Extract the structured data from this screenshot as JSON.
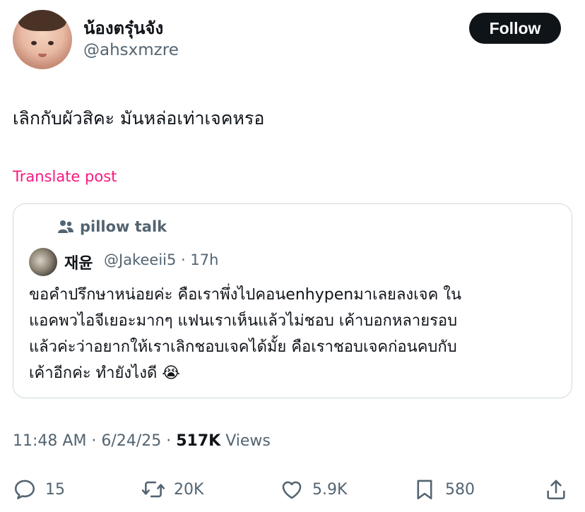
{
  "author": {
    "display_name": "น้องตรุ๋นจัง",
    "handle": "@ahsxmzre",
    "avatar_icon": "user-avatar"
  },
  "follow_label": "Follow",
  "post": {
    "text": "เลิกกับผัวสิคะ มันหล่อเท่าเจคหรอ",
    "translate_label": "Translate post"
  },
  "quote": {
    "community": "pillow talk",
    "author_name": "재윤",
    "author_handle": "@Jakeeii5",
    "separator": "·",
    "time": "17h",
    "lines": [
      "ขอคำปรึกษาหน่อยค่ะ คือเราพึ่งไปคอนenhypenมาเลยลงเจค ใน",
      "แอคพวไอจีเยอะมากๆ แฟนเราเห็นแล้วไม่ชอบ เค้าบอกหลายรอบ",
      "แล้วค่ะว่าอยากให้เราเลิกชอบเจคได้มั้ย คือเราชอบเจคก่อนคบกับ",
      "เค้าอีกค่ะ ทำยังไงดี 😭"
    ]
  },
  "meta": {
    "time": "11:48 AM",
    "sep1": " · ",
    "date": "6/24/25",
    "sep2": " · ",
    "views_count": "517K",
    "views_label": " Views"
  },
  "actions": {
    "replies": "15",
    "reposts": "20K",
    "likes": "5.9K",
    "bookmarks": "580"
  },
  "colors": {
    "text": "#0f1419",
    "secondary": "#536471",
    "translate": "#f91880",
    "border": "#cfd9de",
    "button": "#0f1419"
  }
}
